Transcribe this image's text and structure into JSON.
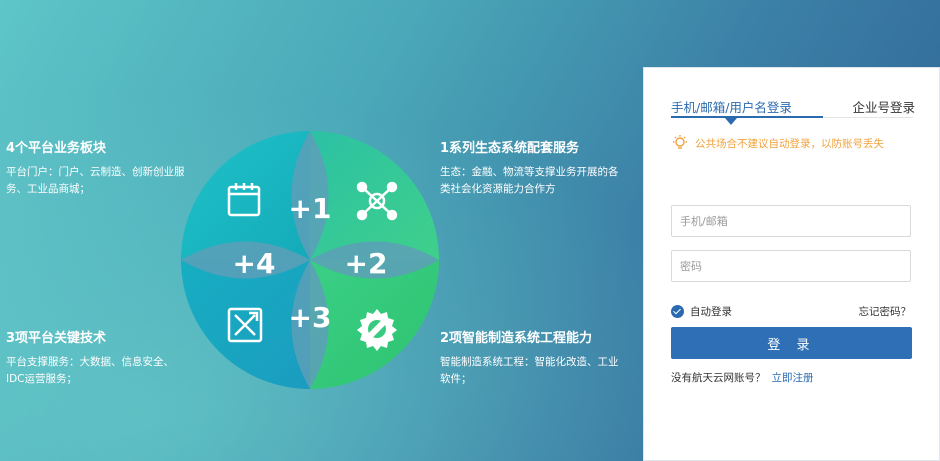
{
  "features": {
    "f1": {
      "title": "4个平台业务板块",
      "desc": "平台门户：门户、云制造、创新创业服务、工业品商城；"
    },
    "f2": {
      "title": "1系列生态系统配套服务",
      "desc": "生态：金融、物流等支撑业务开展的各类社会化资源能力合作方"
    },
    "f3": {
      "title": "3项平台关键技术",
      "desc": "平台支撑服务：大数据、信息安全、IDC运营服务；"
    },
    "f4": {
      "title": "2项智能制造系统工程能力",
      "desc": "智能制造系统工程：智能化改造、工业软件；"
    }
  },
  "diagram": {
    "labels": {
      "plus1": "+1",
      "plus2": "+2",
      "plus3": "+3",
      "plus4": "+4"
    },
    "colors": {
      "teal": "#17b9c6",
      "green": "#3cce80",
      "blue_teal": "#1aa5c4",
      "lens": "#6ca8bf"
    },
    "icons": [
      "calendar-icon",
      "network-icon",
      "gear-wrench-icon",
      "tools-icon"
    ]
  },
  "login": {
    "tab_phone": "手机/邮箱/用户名登录",
    "tab_enterprise": "企业号登录",
    "warning": "公共场合不建议自动登录，以防账号丢失",
    "phone_placeholder": "手机/邮箱",
    "password_placeholder": "密码",
    "remember": "自动登录",
    "forgot": "忘记密码？",
    "submit": "登 录",
    "no_account": "没有航天云网账号？",
    "register": "立即注册"
  }
}
